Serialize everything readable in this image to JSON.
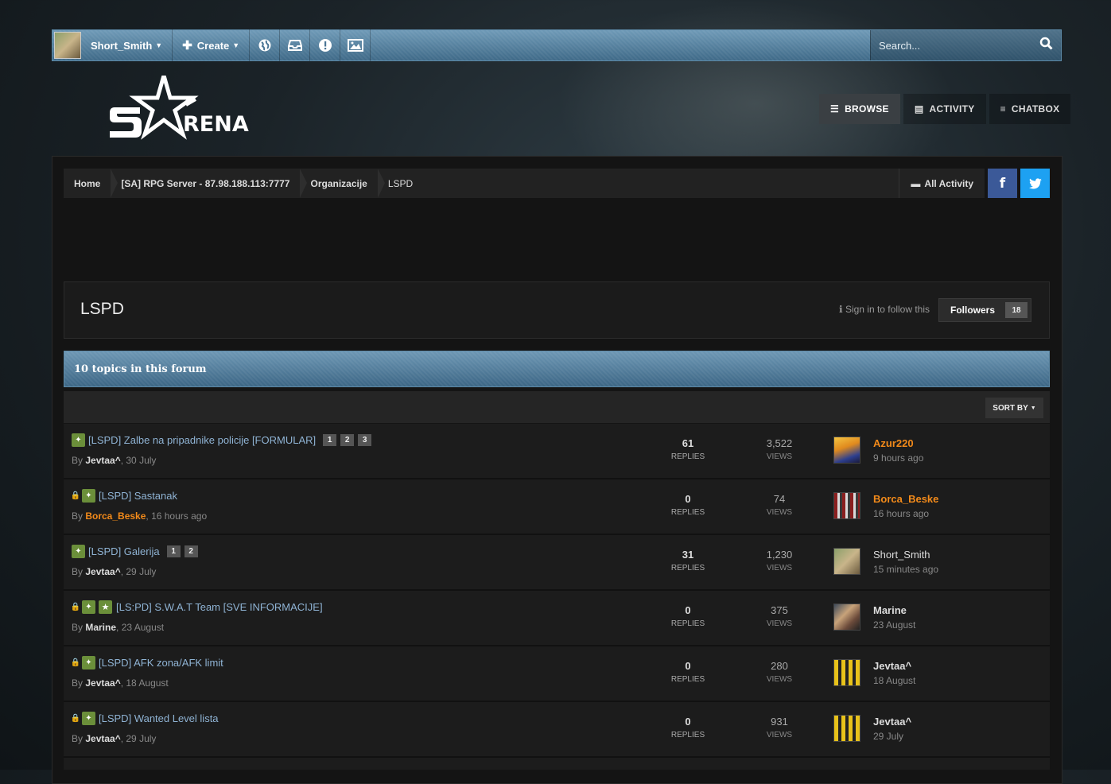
{
  "userbar": {
    "username": "Short_Smith",
    "create_label": "Create",
    "search_placeholder": "Search..."
  },
  "logo": {
    "text": "RENA"
  },
  "nav": {
    "browse": "BROWSE",
    "activity": "ACTIVITY",
    "chatbox": "CHATBOX"
  },
  "breadcrumb": {
    "items": [
      "Home",
      "[SA] RPG Server - 87.98.188.113:7777",
      "Organizacije",
      "LSPD"
    ],
    "all_activity": "All Activity"
  },
  "forum": {
    "title": "LSPD",
    "sign_in": "Sign in to follow this",
    "followers_label": "Followers",
    "followers_count": "18",
    "topics_count_label": "10 topics in this forum",
    "sort_by": "SORT BY"
  },
  "labels": {
    "replies": "REPLIES",
    "views": "VIEWS",
    "by": "By "
  },
  "topics": [
    {
      "title": "[LSPD] Zalbe na pripadnike policije [FORMULAR]",
      "pages": [
        "1",
        "2",
        "3"
      ],
      "author": "Jevtaa^",
      "date": ", 30 July",
      "replies": "61",
      "views": "3,522",
      "last_user": "Azur220",
      "last_time": "9 hours ago"
    },
    {
      "title": "[LSPD] Sastanak",
      "pages": [],
      "author": "Borca_Beske",
      "date": ", 16 hours ago",
      "replies": "0",
      "views": "74",
      "last_user": "Borca_Beske",
      "last_time": "16 hours ago"
    },
    {
      "title": "[LSPD] Galerija",
      "pages": [
        "1",
        "2"
      ],
      "author": "Jevtaa^",
      "date": ", 29 July",
      "replies": "31",
      "views": "1,230",
      "last_user": "Short_Smith",
      "last_time": "15 minutes ago"
    },
    {
      "title": "[LS:PD] S.W.A.T Team [SVE INFORMACIJE]",
      "pages": [],
      "author": "Marine",
      "date": ", 23 August",
      "replies": "0",
      "views": "375",
      "last_user": "Marine",
      "last_time": "23 August"
    },
    {
      "title": "[LSPD] AFK zona/AFK limit",
      "pages": [],
      "author": "Jevtaa^",
      "date": ", 18 August",
      "replies": "0",
      "views": "280",
      "last_user": "Jevtaa^",
      "last_time": "18 August"
    },
    {
      "title": "[LSPD] Wanted Level lista",
      "pages": [],
      "author": "Jevtaa^",
      "date": ", 29 July",
      "replies": "0",
      "views": "931",
      "last_user": "Jevtaa^",
      "last_time": "29 July"
    }
  ],
  "colors": {
    "accent": "#4f7a99",
    "highlight_user": "#f28a1a",
    "topic_link": "#8fb3d4",
    "pin": "#6b8f3a"
  }
}
